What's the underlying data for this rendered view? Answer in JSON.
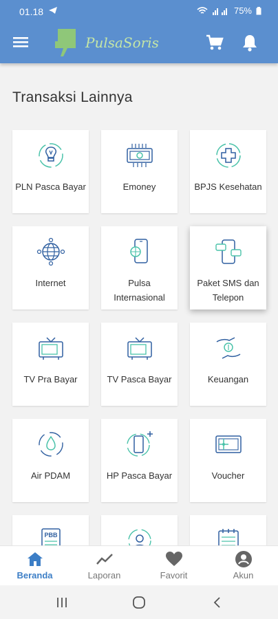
{
  "status": {
    "time": "01.18",
    "battery": "75%"
  },
  "colors": {
    "primary": "#5b8fcf",
    "accent": "#3c7ec6",
    "icon": "#2f5fa0",
    "icon_accent": "#49c2a9"
  },
  "appbar": {
    "logo_text": "PulsaSoris"
  },
  "page": {
    "title": "Transaksi Lainnya"
  },
  "items": [
    {
      "label": "PLN Pasca Bayar",
      "icon": "bulb-icon"
    },
    {
      "label": "Emoney",
      "icon": "emoney-card-icon"
    },
    {
      "label": "BPJS Kesehatan",
      "icon": "health-cross-icon"
    },
    {
      "label": "Internet",
      "icon": "globe-network-icon"
    },
    {
      "label": "Pulsa Internasional",
      "icon": "phone-globe-icon"
    },
    {
      "label": "Paket SMS dan Telepon",
      "icon": "phone-chat-icon"
    },
    {
      "label": "TV Pra Bayar",
      "icon": "tv-icon"
    },
    {
      "label": "TV Pasca Bayar",
      "icon": "tv-icon"
    },
    {
      "label": "Keuangan",
      "icon": "money-hand-icon"
    },
    {
      "label": "Air PDAM",
      "icon": "water-drop-icon"
    },
    {
      "label": "HP Pasca Bayar",
      "icon": "phone-plus-icon"
    },
    {
      "label": "Voucher",
      "icon": "voucher-icon"
    },
    {
      "label": "",
      "icon": "pbb-document-icon",
      "badge": "PBB"
    },
    {
      "label": "",
      "icon": "person-cycle-icon"
    },
    {
      "label": "",
      "icon": "calendar-icon"
    }
  ],
  "bottom_nav": [
    {
      "label": "Beranda",
      "icon": "home-icon",
      "active": true
    },
    {
      "label": "Laporan",
      "icon": "trend-icon"
    },
    {
      "label": "Favorit",
      "icon": "heart-icon"
    },
    {
      "label": "Akun",
      "icon": "account-icon"
    }
  ]
}
